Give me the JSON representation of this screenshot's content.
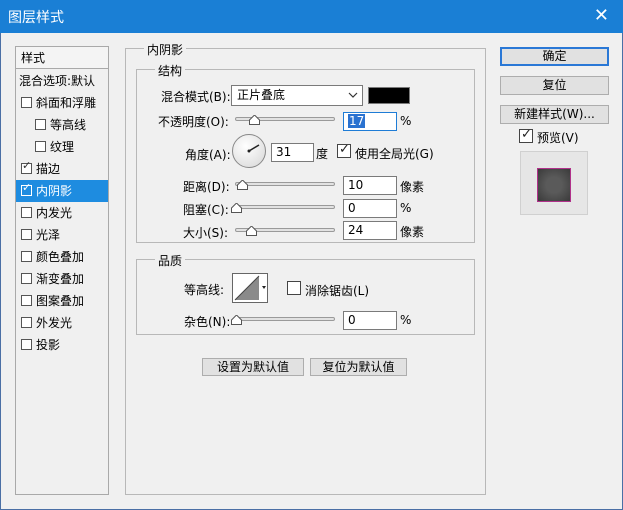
{
  "window": {
    "title": "图层样式",
    "close_glyph": "✕"
  },
  "sidebar": {
    "header": "样式",
    "items": [
      {
        "label": "混合选项:默认",
        "checkbox": false
      },
      {
        "label": "斜面和浮雕",
        "checkbox": true,
        "checked": false
      },
      {
        "label": "等高线",
        "checkbox": true,
        "checked": false,
        "indent": true
      },
      {
        "label": "纹理",
        "checkbox": true,
        "checked": false,
        "indent": true
      },
      {
        "label": "描边",
        "checkbox": true,
        "checked": true
      },
      {
        "label": "内阴影",
        "checkbox": true,
        "checked": true,
        "selected": true
      },
      {
        "label": "内发光",
        "checkbox": true,
        "checked": false
      },
      {
        "label": "光泽",
        "checkbox": true,
        "checked": false
      },
      {
        "label": "颜色叠加",
        "checkbox": true,
        "checked": false
      },
      {
        "label": "渐变叠加",
        "checkbox": true,
        "checked": false
      },
      {
        "label": "图案叠加",
        "checkbox": true,
        "checked": false
      },
      {
        "label": "外发光",
        "checkbox": true,
        "checked": false
      },
      {
        "label": "投影",
        "checkbox": true,
        "checked": false
      }
    ]
  },
  "inner_shadow": {
    "legend": "内阴影",
    "structure": {
      "legend": "结构",
      "blend_mode_label": "混合模式(B):",
      "blend_mode_value": "正片叠底",
      "shadow_color": "#000000",
      "opacity_label": "不透明度(O):",
      "opacity_value": "17",
      "opacity_unit": "%",
      "angle_label": "角度(A):",
      "angle_value": "31",
      "angle_unit": "度",
      "global_light_label": "使用全局光(G)",
      "global_light_checked": true,
      "distance_label": "距离(D):",
      "distance_value": "10",
      "distance_unit": "像素",
      "choke_label": "阻塞(C):",
      "choke_value": "0",
      "choke_unit": "%",
      "size_label": "大小(S):",
      "size_value": "24",
      "size_unit": "像素"
    },
    "quality": {
      "legend": "品质",
      "contour_label": "等高线:",
      "antialias_label": "消除锯齿(L)",
      "antialias_checked": false,
      "noise_label": "杂色(N):",
      "noise_value": "0",
      "noise_unit": "%"
    },
    "make_default": "设置为默认值",
    "reset_default": "复位为默认值"
  },
  "right": {
    "ok": "确定",
    "reset": "复位",
    "new_style": "新建样式(W)...",
    "preview_label": "预览(V)",
    "preview_checked": true
  },
  "colors": {
    "accent": "#1e8ce0",
    "title_bar": "#1a7fd5",
    "selection": "#2a72d0"
  }
}
